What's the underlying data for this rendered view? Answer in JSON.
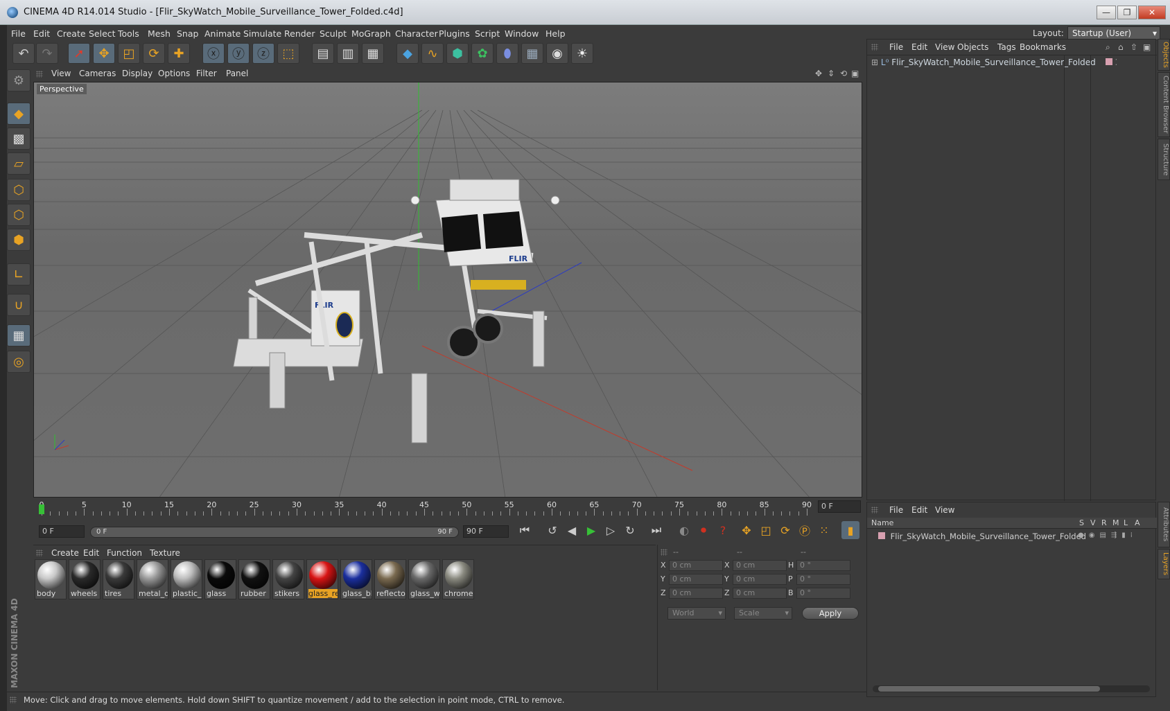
{
  "window": {
    "title": "CINEMA 4D R14.014 Studio - [Flir_SkyWatch_Mobile_Surveillance_Tower_Folded.c4d]",
    "min_glyph": "—",
    "max_glyph": "❐",
    "close_glyph": "✕"
  },
  "menubar": {
    "items": [
      "File",
      "Edit",
      "Create",
      "Select",
      "Tools",
      "Mesh",
      "Snap",
      "Animate",
      "Simulate",
      "Render",
      "Sculpt",
      "MoGraph",
      "Character",
      "Plugins",
      "Script",
      "Window",
      "Help"
    ],
    "layout_label": "Layout:",
    "layout_value": "Startup (User)"
  },
  "viewport": {
    "menu": [
      "View",
      "Cameras",
      "Display",
      "Options",
      "Filter",
      "Panel"
    ],
    "label": "Perspective",
    "model_text": "FLIR"
  },
  "timeline": {
    "ticks": [
      0,
      5,
      10,
      15,
      20,
      25,
      30,
      35,
      40,
      45,
      50,
      55,
      60,
      65,
      70,
      75,
      80,
      85,
      90
    ],
    "current_frame": "0 F",
    "start_field": "0 F",
    "slider_start": "0 F",
    "slider_end": "90 F",
    "end_field": "90 F"
  },
  "materials": {
    "menu": [
      "Create",
      "Edit",
      "Function",
      "Texture"
    ],
    "items": [
      {
        "name": "body",
        "color": "#c8c8c8"
      },
      {
        "name": "wheels",
        "color": "#2a2a2a"
      },
      {
        "name": "tires",
        "color": "#3a3a3a"
      },
      {
        "name": "metal_d",
        "color": "#9a9a9a"
      },
      {
        "name": "plastic_(",
        "color": "#bdbdbd"
      },
      {
        "name": "glass",
        "color": "#0a0a0a"
      },
      {
        "name": "rubber",
        "color": "#111111"
      },
      {
        "name": "stikers",
        "color": "#444444"
      },
      {
        "name": "glass_re",
        "color": "#d81414"
      },
      {
        "name": "glass_bl",
        "color": "#1b2f9e"
      },
      {
        "name": "reflecto",
        "color": "#7a6a50"
      },
      {
        "name": "glass_w",
        "color": "#6a6a6a"
      },
      {
        "name": "chrome",
        "color": "#8a8a80"
      }
    ],
    "selected_index": 8
  },
  "coords": {
    "header": [
      "--",
      "--",
      "--"
    ],
    "rows": [
      {
        "l1": "X",
        "v1": "0 cm",
        "l2": "X",
        "v2": "0 cm",
        "l3": "H",
        "v3": "0 °"
      },
      {
        "l1": "Y",
        "v1": "0 cm",
        "l2": "Y",
        "v2": "0 cm",
        "l3": "P",
        "v3": "0 °"
      },
      {
        "l1": "Z",
        "v1": "0 cm",
        "l2": "Z",
        "v2": "0 cm",
        "l3": "B",
        "v3": "0 °"
      }
    ],
    "world": "World",
    "scale": "Scale",
    "apply": "Apply"
  },
  "objects_panel": {
    "menu": [
      "File",
      "Edit",
      "View",
      "Objects",
      "Tags",
      "Bookmarks"
    ],
    "root": "Flir_SkyWatch_Mobile_Surveillance_Tower_Folded"
  },
  "layers_panel": {
    "menu": [
      "File",
      "Edit",
      "View"
    ],
    "header": {
      "name": "Name",
      "cols": [
        "S",
        "V",
        "R",
        "M",
        "L",
        "A"
      ]
    },
    "row": "Flir_SkyWatch_Mobile_Surveillance_Tower_Folded"
  },
  "side_tabs": [
    "Objects",
    "Content Browser",
    "Structure",
    "Attributes",
    "Layers"
  ],
  "status": "Move: Click and drag to move elements. Hold down SHIFT to quantize movement / add to the selection in point mode, CTRL to remove.",
  "brand": "MAXON CINEMA 4D",
  "colors": {
    "accent": "#e8a324",
    "selected": "#596b7a",
    "bg": "#3b3b3b"
  }
}
